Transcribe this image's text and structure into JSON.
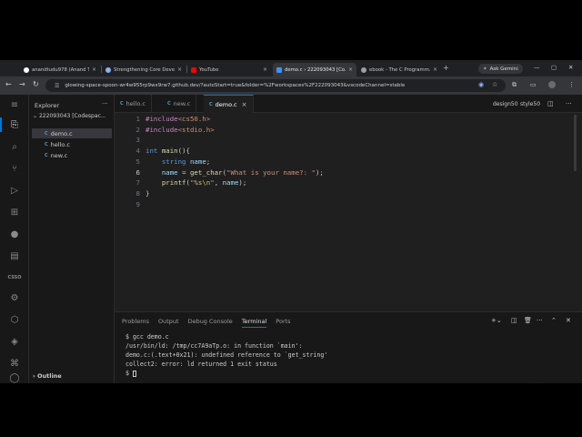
{
  "browser": {
    "tabs": [
      {
        "title": "anandtudu978 (Anand Tu...",
        "icon": "github-icon",
        "active": false
      },
      {
        "title": "Strengthening Core Devel...",
        "icon": "site-icon",
        "active": false
      },
      {
        "title": "YouTube",
        "icon": "youtube-icon",
        "active": false
      },
      {
        "title": "demo.c › 222093043 [Co...",
        "icon": "vscode-icon",
        "active": true
      },
      {
        "title": "ebook - The C Programm...",
        "icon": "globe-icon",
        "active": false
      }
    ],
    "new_tab": "+",
    "ask_gemini": "Ask Gemini",
    "url": "glowing-space-spoon-wr4w955rp9wx9rw7.github.dev/?autoStart=true&folder=%2Fworkspaces%2F222093043&vscodeChannel=stable"
  },
  "activity": {
    "csso_label": "CSSO"
  },
  "explorer": {
    "title": "Explorer",
    "more": "···",
    "folder": "222093043 [Codespac...",
    "files": [
      {
        "name": "demo.c",
        "selected": true
      },
      {
        "name": "hello.c",
        "selected": false
      },
      {
        "name": "new.c",
        "selected": false
      }
    ],
    "outline": "Outline"
  },
  "editor": {
    "tabs": [
      {
        "name": "hello.c",
        "active": false
      },
      {
        "name": "new.c",
        "active": false
      },
      {
        "name": "demo.c",
        "active": true
      }
    ],
    "extensions": [
      "design50",
      "style50"
    ],
    "line_numbers": [
      "1",
      "2",
      "3",
      "4",
      "5",
      "6",
      "7",
      "8",
      "9"
    ],
    "code_lines": [
      "#include<cs50.h>",
      "#include<stdio.h>",
      "",
      "int main(){",
      "    string name;",
      "    name = get_char(\"What is your name?: \");",
      "    printf(\"%s\\n\", name);",
      "}",
      ""
    ]
  },
  "panel": {
    "tabs": [
      "Problems",
      "Output",
      "Debug Console",
      "Terminal",
      "Ports"
    ],
    "active_tab": "Terminal",
    "terminal_lines": [
      "$ gcc demo.c",
      "/usr/bin/ld: /tmp/cc7A9aTp.o: in function `main':",
      "demo.c:(.text+0x21): undefined reference to `get_string'",
      "collect2: error: ld returned 1 exit status",
      "$ "
    ]
  },
  "colors": {
    "accent": "#0078d4",
    "keyword": "#569cd6",
    "preprocessor": "#c586c0",
    "function": "#dcdcaa",
    "string": "#ce9178",
    "variable": "#9cdcfe"
  }
}
